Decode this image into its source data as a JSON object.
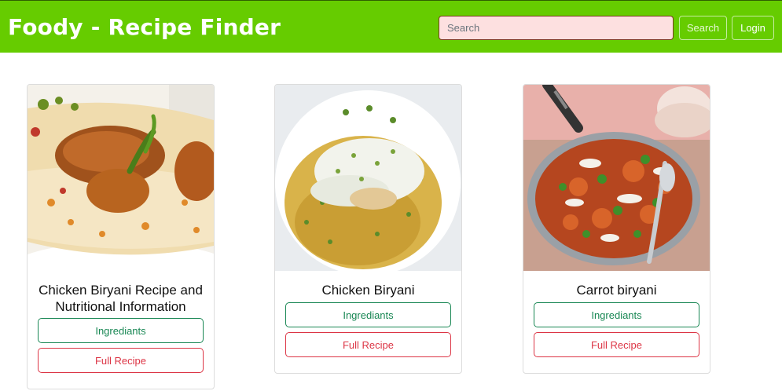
{
  "navbar": {
    "brand": "Foody - Recipe Finder",
    "search_placeholder": "Search",
    "search_button": "Search",
    "login_button": "Login"
  },
  "recipes": [
    {
      "title": "Chicken Biryani Recipe and Nutritional Information",
      "ingredients_label": "Ingrediants",
      "full_recipe_label": "Full Recipe",
      "image": "chicken-biryani-platter-image"
    },
    {
      "title": "Chicken Biryani",
      "ingredients_label": "Ingrediants",
      "full_recipe_label": "Full Recipe",
      "image": "chicken-biryani-yogurt-image"
    },
    {
      "title": "Carrot biryani",
      "ingredients_label": "Ingrediants",
      "full_recipe_label": "Full Recipe",
      "image": "carrot-biryani-pan-image"
    }
  ],
  "colors": {
    "navbar": "#66cc00",
    "ingredients_outline": "#198754",
    "full_recipe_outline": "#dc3545",
    "search_field": "#fde0e0"
  }
}
